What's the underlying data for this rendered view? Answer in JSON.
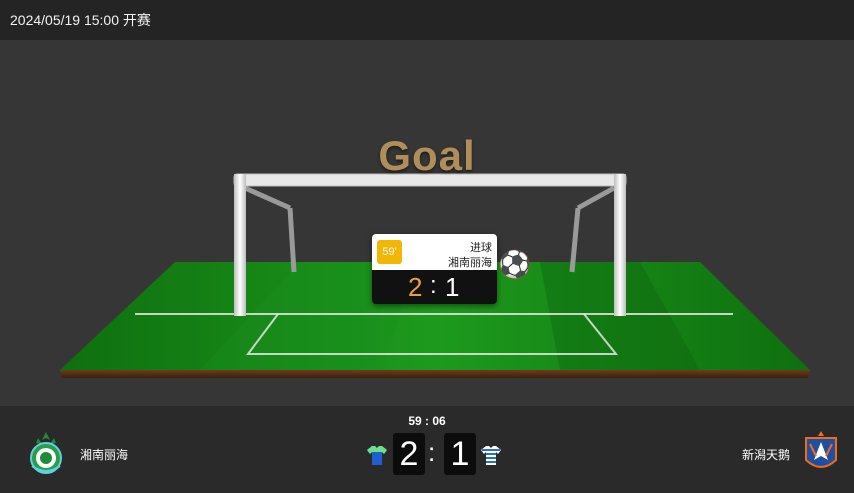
{
  "match": {
    "datetime": "2024/05/19 15:00 开赛"
  },
  "animation": {
    "headline": "Goal",
    "event": {
      "minute": "59'",
      "type": "进球",
      "team": "湘南丽海",
      "score_home": "2",
      "score_sep": ":",
      "score_away": "1"
    },
    "ball_icon": "soccer-ball-icon"
  },
  "scoreboard": {
    "clock": "59 : 06",
    "home": {
      "name": "湘南丽海",
      "score": "2",
      "logo_icon": "shonan-bellmare-crest-icon",
      "shirt_icon": "home-shirt-icon"
    },
    "separator": ":",
    "away": {
      "name": "新潟天鹅",
      "score": "1",
      "logo_icon": "albirex-niigata-crest-icon",
      "shirt_icon": "away-shirt-icon"
    }
  },
  "colors": {
    "accent_score": "#f0a030",
    "minute_badge": "#f2b705",
    "headline": "#b08d5a",
    "pitch_green": "#1a8a1a"
  }
}
